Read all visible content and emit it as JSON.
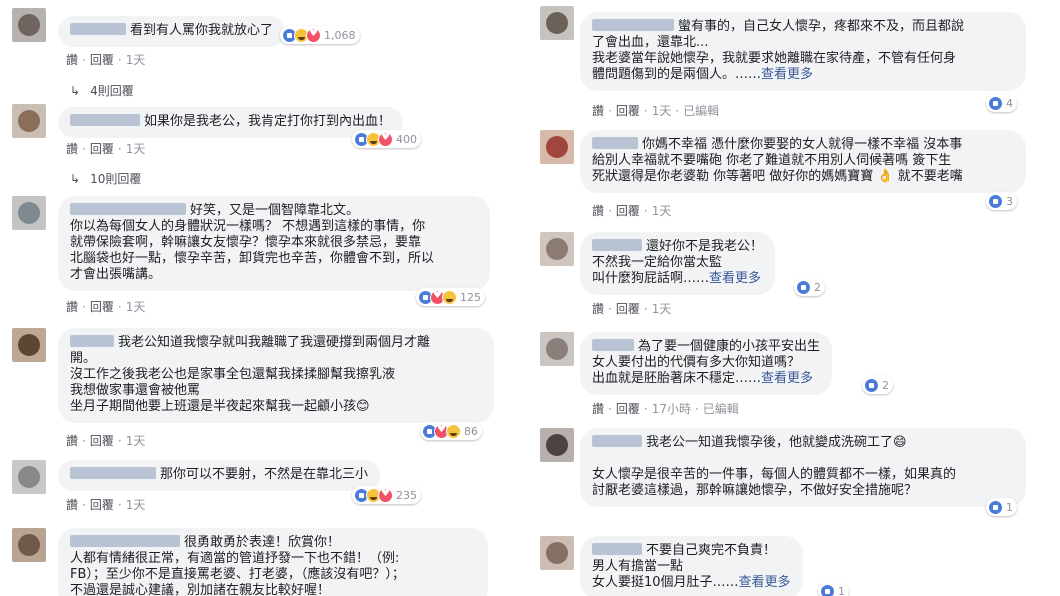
{
  "left": [
    {
      "text": "看到有人罵你我就放心了",
      "reactions": "1,068",
      "reply_label": "讚",
      "reply_btn": "回覆",
      "time": "1天",
      "replies": "4則回覆"
    },
    {
      "text": "如果你是我老公，我肯定打你打到內出血！",
      "reactions": "400",
      "reply_label": "讚",
      "reply_btn": "回覆",
      "time": "1天",
      "replies": "10則回覆"
    },
    {
      "text": "好笑，又是一個智障靠北文。\n你以為每個女人的身體狀況一樣嗎？ 不想遇到這樣的事情，你\n就帶保險套啊，幹嘛讓女友懷孕？懷孕本來就很多禁忌，要靠\n北腦袋也好一點，懷孕辛苦，卸貨完也辛苦，你體會不到，所以\n才會出張嘴講。",
      "reactions": "125",
      "reply_label": "讚",
      "reply_btn": "回覆",
      "time": "1天"
    },
    {
      "text": "我老公知道我懷孕就叫我離職了我還硬撐到兩個月才離\n開。\n沒工作之後我老公也是家事全包還幫我揉揉腳幫我擦乳液\n我想做家事還會被他罵\n坐月子期間他要上班還是半夜起來幫我一起顧小孩😊",
      "reactions": "86",
      "reply_label": "讚",
      "reply_btn": "回覆",
      "time": "1天"
    },
    {
      "text": "那你可以不要射，不然是在靠北三小",
      "reactions": "235",
      "reply_label": "讚",
      "reply_btn": "回覆",
      "time": "1天"
    },
    {
      "text": "很勇敢勇於表達！欣賞你！\n人都有情緒很正常，有適當的管道抒發一下也不錯！（例:\nFB）；至少你不是直接罵老婆、打老婆，（應該沒有吧？）；\n不過還是誠心建議，別加諸在親友比較好喔！"
    }
  ],
  "right": [
    {
      "text": "蠻有事的，自己女人懷孕，疼都來不及，而且都說\n了會出血，還靠北...\n我老婆當年說她懷孕，我就要求她離職在家待產，不管有任何身\n體問題傷到的是兩個人。……",
      "more": "查看更多",
      "reactions": "4",
      "reply_label": "讚",
      "reply_btn": "回覆",
      "time": "1天",
      "edited": "已編輯"
    },
    {
      "text": "你媽不幸福 憑什麼你要娶的女人就得一樣不幸福 沒本事\n給別人幸福就不要嘴砲 你老了難道就不用別人伺候著嗎 簽下生\n死狀還得是你老婆勒 你等著吧 做好你的媽媽寶寶 👌 就不要老嘴",
      "reactions": "3",
      "reply_label": "讚",
      "reply_btn": "回覆",
      "time": "1天"
    },
    {
      "text": "還好你不是我老公！\n不然我一定給你當太監\n叫什麼狗屁話啊……",
      "more": "查看更多",
      "reactions": "2",
      "reply_label": "讚",
      "reply_btn": "回覆",
      "time": "1天"
    },
    {
      "text": "為了要一個健康的小孩平安出生\n女人要付出的代價有多大你知道嗎？\n出血就是胚胎著床不穩定……",
      "more": "查看更多",
      "reactions": "2",
      "reply_label": "讚",
      "reply_btn": "回覆",
      "time": "17小時",
      "edited": "已編輯"
    },
    {
      "text": "我老公一知道我懷孕後，他就變成洗碗工了😄\n\n女人懷孕是很辛苦的一件事，每個人的體質都不一樣，如果真的\n討厭老婆這樣過，那幹嘛讓她懷孕，不做好安全措施呢？",
      "reactions": "1"
    },
    {
      "text": "不要自己爽完不負責！\n男人有擔當一點\n女人要挺10個月肚子……",
      "more": "查看更多",
      "reactions": "1"
    }
  ]
}
